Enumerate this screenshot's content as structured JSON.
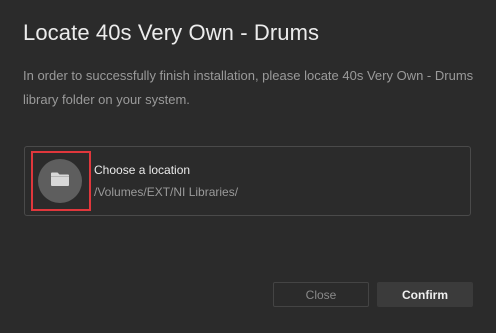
{
  "dialog": {
    "title": "Locate 40s Very Own - Drums",
    "description": "In order to successfully finish installation, please locate 40s Very Own - Drums library folder on your system."
  },
  "location": {
    "label": "Choose a location",
    "path": "/Volumes/EXT/NI Libraries/",
    "icon": "folder-icon"
  },
  "buttons": {
    "close_label": "Close",
    "confirm_label": "Confirm"
  },
  "colors": {
    "background": "#2b2b2b",
    "highlight": "#e0373c",
    "folder_circle": "#5e5e5e"
  }
}
